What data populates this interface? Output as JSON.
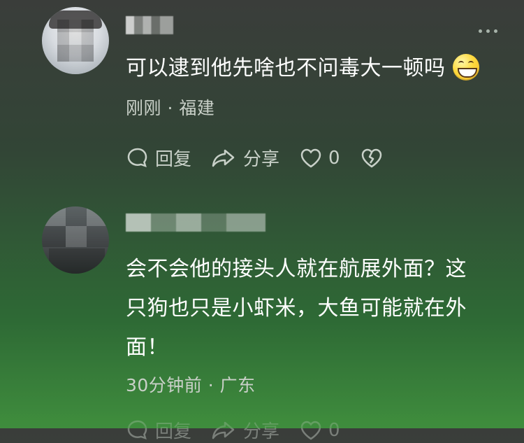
{
  "comments": [
    {
      "text": "可以逮到他先啥也不问毒大一顿吗",
      "time_location": "刚刚 · 福建",
      "actions": {
        "reply": "回复",
        "share": "分享",
        "like_count": "0"
      }
    },
    {
      "text_lines": [
        "会不会他的接头人就在航展外面？这",
        "只狗也只是小虾米，大鱼可能就在外",
        "面！"
      ],
      "time_location": "30分钟前 · 广东",
      "actions": {
        "reply": "回复",
        "share": "分享",
        "like_count": "0"
      }
    }
  ],
  "colors": {
    "text": "#ffffff",
    "meta": "#c9d0c8",
    "icon": "#c8d0c8"
  },
  "icons": {
    "more": "more-horizontal-icon",
    "reply": "comment-bubble-icon",
    "share": "share-arrow-icon",
    "like": "heart-icon",
    "dislike": "broken-heart-icon",
    "emoji": "grinning-face-emoji-icon"
  }
}
